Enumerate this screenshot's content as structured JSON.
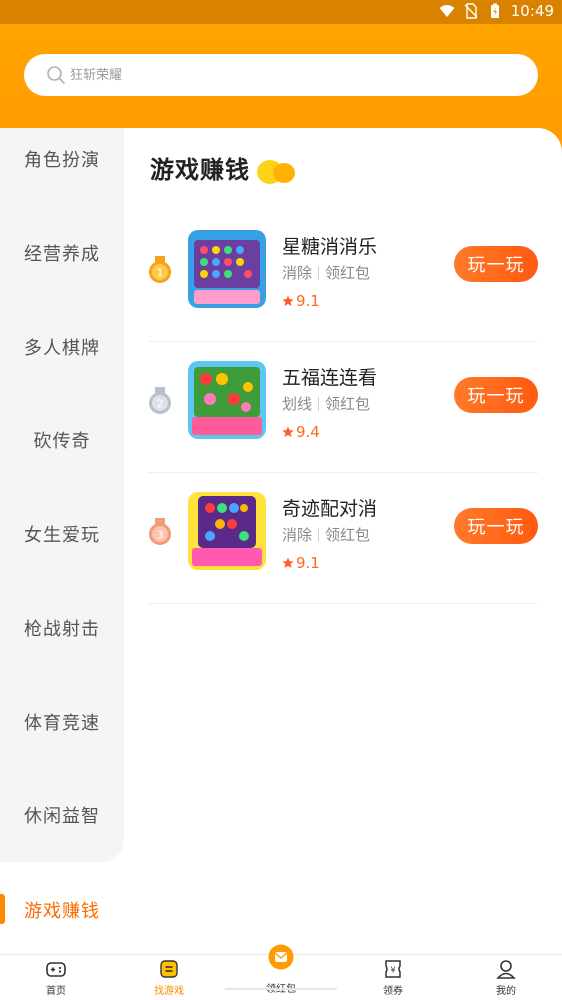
{
  "status_bar": {
    "time": "10:49"
  },
  "search": {
    "placeholder": "狂斩荣耀"
  },
  "sidebar": {
    "items": [
      {
        "label": "角色扮演"
      },
      {
        "label": "经营养成"
      },
      {
        "label": "多人棋牌"
      },
      {
        "label": "砍传奇"
      },
      {
        "label": "女生爱玩"
      },
      {
        "label": "枪战射击"
      },
      {
        "label": "体育竞速"
      },
      {
        "label": "休闲益智"
      },
      {
        "label": "游戏赚钱",
        "active": true
      }
    ]
  },
  "section": {
    "title": "游戏赚钱"
  },
  "games": [
    {
      "rank": "1",
      "name": "星糖消消乐",
      "tags": [
        "消除",
        "领红包"
      ],
      "rating": "9.1",
      "button": "玩一玩",
      "rank_color": "#f3a51b"
    },
    {
      "rank": "2",
      "name": "五福连连看",
      "tags": [
        "划线",
        "领红包"
      ],
      "rating": "9.4",
      "button": "玩一玩",
      "rank_color": "#b9c0cc"
    },
    {
      "rank": "3",
      "name": "奇迹配对消",
      "tags": [
        "消除",
        "领红包"
      ],
      "rating": "9.1",
      "button": "玩一玩",
      "rank_color": "#f29a7a"
    }
  ],
  "bottom_nav": {
    "items": [
      {
        "label": "首页",
        "icon": "gamepad-icon"
      },
      {
        "label": "找游戏",
        "icon": "find-game-icon",
        "active": true
      },
      {
        "label": "领红包",
        "icon": "red-envelope-icon"
      },
      {
        "label": "领券",
        "icon": "coupon-icon"
      },
      {
        "label": "我的",
        "icon": "profile-icon"
      }
    ]
  },
  "colors": {
    "accent": "#ff9a00",
    "button": "#ff5a10",
    "active_text": "#ff6a00"
  }
}
